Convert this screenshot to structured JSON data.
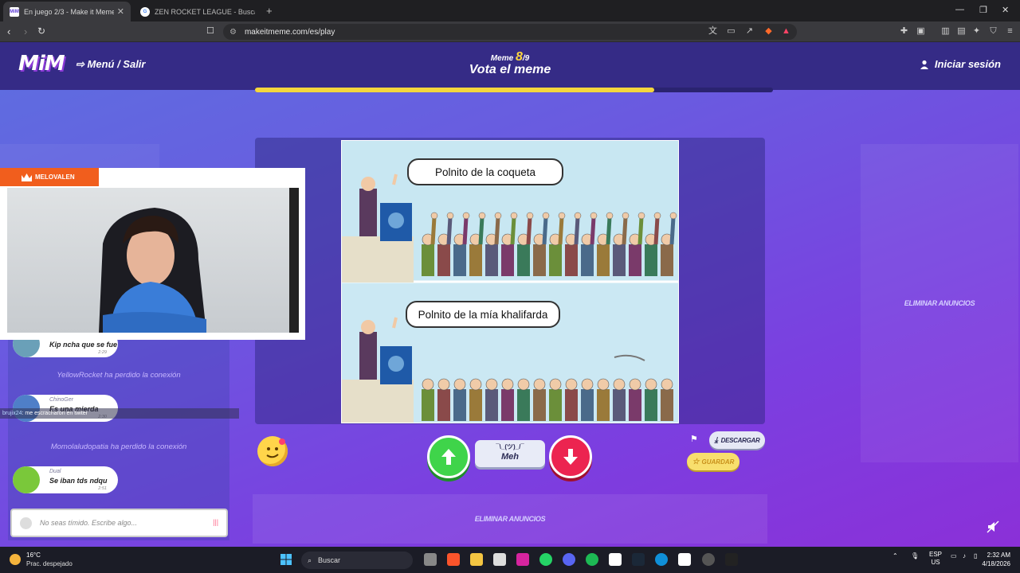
{
  "browser": {
    "tabs": [
      {
        "title": "En juego 2/3 - Make it Meme",
        "favicon": "MiM",
        "active": true
      },
      {
        "title": "ZEN ROCKET LEAGUE - Buscar con G",
        "favicon": "G",
        "active": false
      }
    ],
    "url": "makeitmeme.com/es/play"
  },
  "site": {
    "logo": "MiM",
    "menu_label": "Menú / Salir",
    "meme_prefix": "Meme",
    "meme_current": "8",
    "meme_total": "/9",
    "title": "Vota el meme",
    "login_label": "Iniciar sesión",
    "progress": 0.77,
    "ad_label": "ELIMINAR ANUNCIOS",
    "meh_face": "¯\\_(ツ)_/¯",
    "meh_label": "Meh",
    "download_label": "DESCARGAR",
    "save_label": "GUARDAR"
  },
  "meme": {
    "caption_top": "Polnito de la coqueta",
    "caption_bottom": "Polnito de la mía khalifarda"
  },
  "stream": {
    "channel": "MELOVALEN",
    "overlay_user": "brujix24",
    "overlay_msg": ": me escracharon en twiter"
  },
  "chat": {
    "messages": [
      {
        "user": "",
        "text": "Kip ncha que se fue",
        "time": "2:29"
      },
      {
        "user": "ChinoGer",
        "text": "Es una mierda",
        "time": "2:30"
      },
      {
        "user": "Dual",
        "text": "Se iban tds ndqu",
        "time": "2:51"
      }
    ],
    "system": [
      "YellowRocket ha perdido la conexión",
      "Momolaludopatia ha perdido la conexión"
    ],
    "input_placeholder": "No seas tímido. Escribe algo..."
  },
  "taskbar": {
    "temperature": "16°C",
    "weather": "Prac. despejado",
    "search": "Buscar",
    "lang": "ESP",
    "layout": "US",
    "time": "2:32 AM",
    "date": "4/18/2026"
  }
}
